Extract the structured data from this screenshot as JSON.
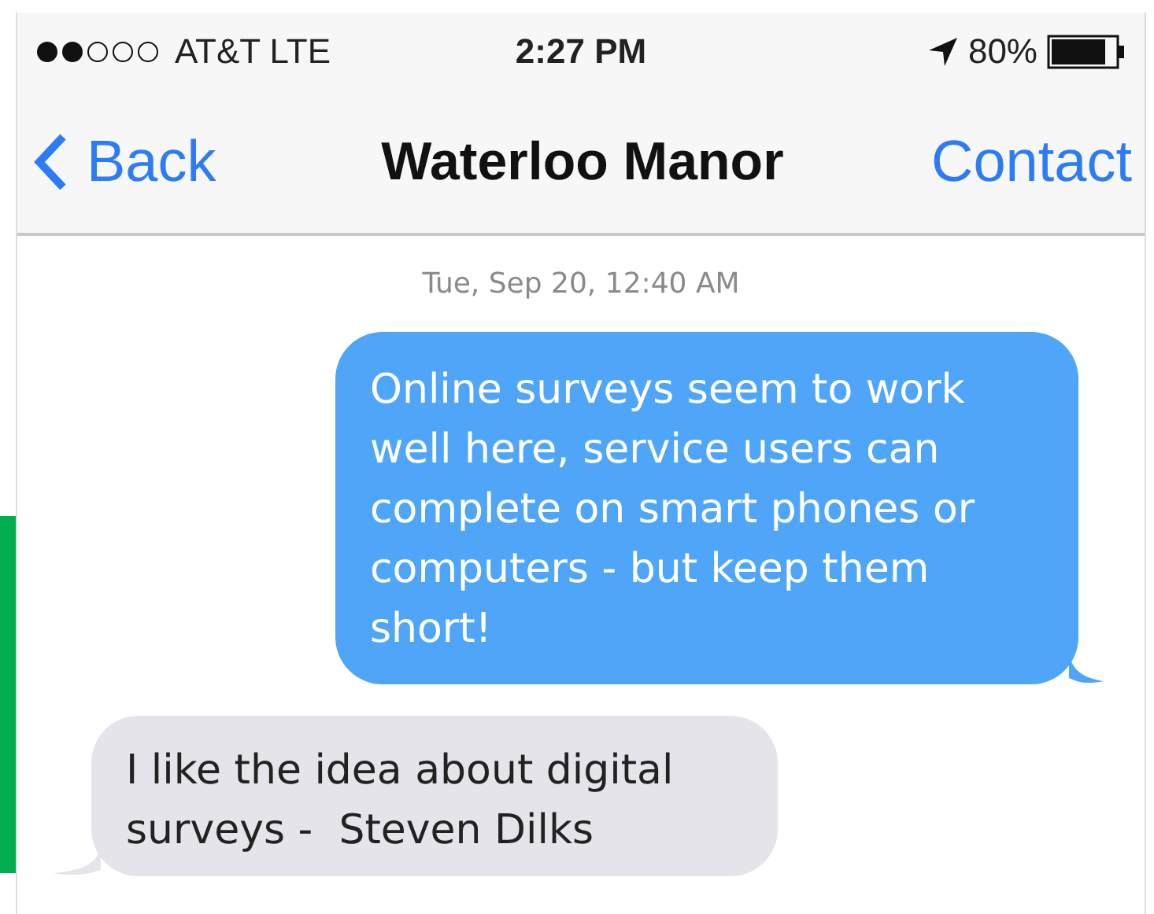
{
  "status_bar": {
    "carrier": "AT&T LTE",
    "time": "2:27 PM",
    "battery": "80%"
  },
  "nav": {
    "back": "Back",
    "title": "Waterloo Manor",
    "action": "Contact"
  },
  "timestamp": "Tue, Sep 20, 12:40 AM",
  "messages": [
    {
      "kind": "sent",
      "text": "Online surveys seem to work well here, service users can complete on smart phones or computers - but keep them short!"
    },
    {
      "kind": "received",
      "text": "I like the idea about digital surveys -  Steven Dilks"
    }
  ]
}
